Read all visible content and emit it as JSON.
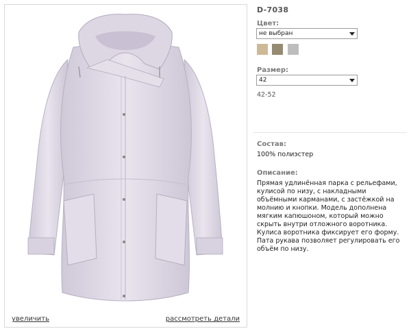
{
  "product": {
    "sku": "D-7038",
    "photo_alt": "light lilac hooded parka",
    "zoom_label": "увеличить",
    "details_label": "рассмотреть детали"
  },
  "color": {
    "label": "Цвет:",
    "selected": "не выбран",
    "swatches": [
      {
        "name": "beige",
        "hex": "#cdb995"
      },
      {
        "name": "olive-taupe",
        "hex": "#958a72"
      },
      {
        "name": "grey",
        "hex": "#bdbdbd"
      }
    ]
  },
  "size": {
    "label": "Размер:",
    "selected": "42",
    "range": "42-52"
  },
  "composition": {
    "label": "Состав:",
    "value": "100% полиэстер"
  },
  "description": {
    "label": "Описание:",
    "text": "Прямая удлинённая парка с рельефами, кулисой по низу, с накладными объёмными карманами, с застёжкой на молнию и кнопки. Модель дополнена мягким капюшоном, который можно скрыть внутри отложного воротника. Кулиса воротника фиксирует его форму. Пата рукава позволяет регулировать его объём по низу."
  }
}
